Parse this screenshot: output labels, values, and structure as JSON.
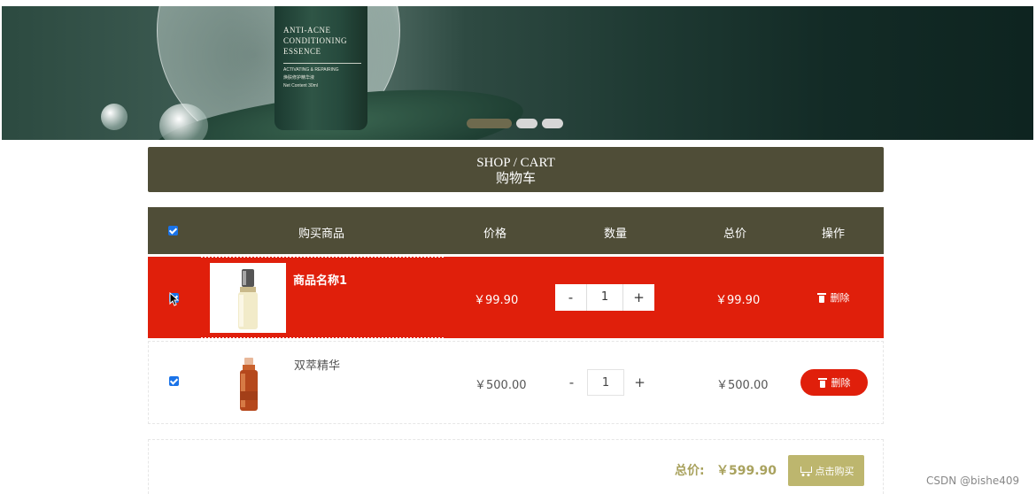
{
  "banner": {
    "bottle_title": "ANTI-ACNE CONDITIONING ESSENCE",
    "bottle_subtitle": "ACTIVATING & REPAIRING",
    "bottle_cn": "焕肤修护精华液",
    "bottle_content": "Net Content 30ml",
    "carousel_active_index": 0,
    "carousel_count": 3
  },
  "title": {
    "en": "SHOP / CART",
    "cn": "购物车"
  },
  "table": {
    "select_all_checked": true,
    "headers": {
      "product": "购买商品",
      "price": "价格",
      "quantity": "数量",
      "total": "总价",
      "action": "操作"
    }
  },
  "items": [
    {
      "name": "商品名称1",
      "price": "￥99.90",
      "quantity": "1",
      "total": "￥99.90",
      "delete_label": "删除",
      "checked": true,
      "highlighted": true
    },
    {
      "name": "双萃精华",
      "price": "￥500.00",
      "quantity": "1",
      "total": "￥500.00",
      "delete_label": "删除",
      "checked": true,
      "highlighted": false
    }
  ],
  "qty_minus": "-",
  "qty_plus": "+",
  "summary": {
    "label": "总价:",
    "value": "￥599.90",
    "buy_label": "点击购买"
  },
  "watermark": "CSDN @bishe409",
  "colors": {
    "header_bg": "#4f4d37",
    "highlight_row": "#e01f0b",
    "accent": "#a9a25e",
    "buy_button": "#bdb66e"
  }
}
